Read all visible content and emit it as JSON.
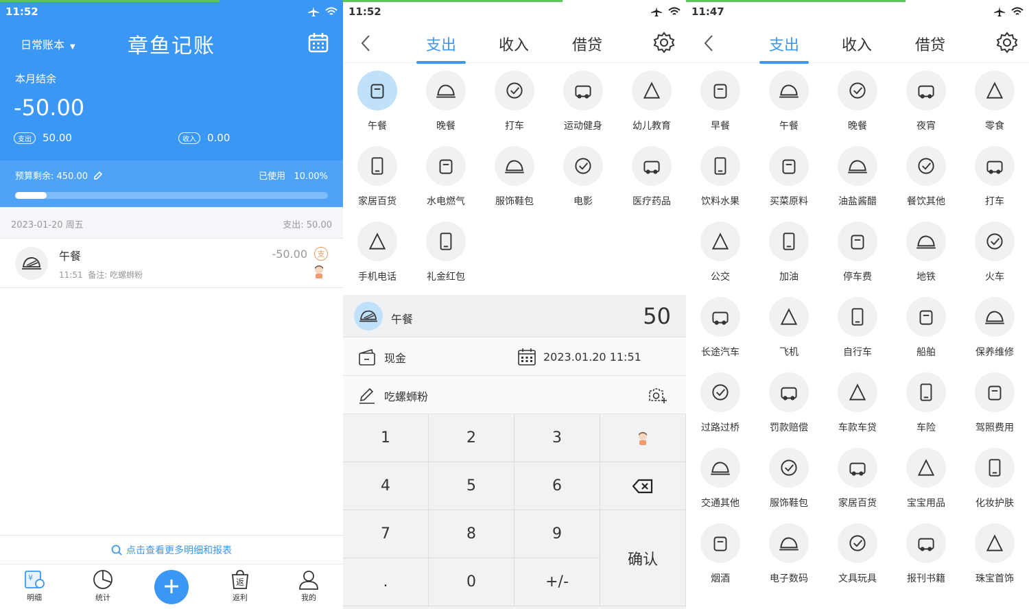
{
  "p1": {
    "status_time": "11:52",
    "book": "日常账本",
    "title": "章鱼记账",
    "balance_label": "本月结余",
    "balance": "-50.00",
    "expense_pill": "支出",
    "expense": "50.00",
    "income_pill": "收入",
    "income": "0.00",
    "budget_left": "预算剩余: 450.00",
    "used_label": "已使用",
    "used_pct": "10.00%",
    "used_fraction": 0.1,
    "day": "2023-01-20 周五",
    "day_total": "支出: 50.00",
    "entry": {
      "name": "午餐",
      "time": "11:51",
      "note": "备注: 吃螺蛳粉",
      "amount": "-50.00",
      "tag": "支"
    },
    "more": "点击查看更多明细和报表",
    "tabs": [
      "明细",
      "统计",
      "返利",
      "我的"
    ]
  },
  "p2": {
    "status_time": "11:52",
    "tabs": [
      "支出",
      "收入",
      "借贷"
    ],
    "categories": [
      "午餐",
      "晚餐",
      "打车",
      "运动健身",
      "幼儿教育",
      "家居百货",
      "水电燃气",
      "服饰鞋包",
      "电影",
      "医疗药品",
      "手机电话",
      "礼金红包"
    ],
    "selected": "午餐",
    "amount": "50",
    "account": "现金",
    "datetime": "2023.01.20 11:51",
    "note": "吃螺蛳粉",
    "keys": [
      "1",
      "2",
      "3",
      "4",
      "5",
      "6",
      "7",
      "8",
      "9",
      ".",
      "0",
      "+/-"
    ],
    "confirm": "确认"
  },
  "p3": {
    "status_time": "11:47",
    "tabs": [
      "支出",
      "收入",
      "借贷"
    ],
    "categories": [
      "早餐",
      "午餐",
      "晚餐",
      "夜宵",
      "零食",
      "饮料水果",
      "买菜原料",
      "油盐酱醋",
      "餐饮其他",
      "打车",
      "公交",
      "加油",
      "停车费",
      "地铁",
      "火车",
      "长途汽车",
      "飞机",
      "自行车",
      "船舶",
      "保养维修",
      "过路过桥",
      "罚款赔偿",
      "车款车贷",
      "车险",
      "驾照费用",
      "交通其他",
      "服饰鞋包",
      "家居百货",
      "宝宝用品",
      "化妆护肤",
      "烟酒",
      "电子数码",
      "文具玩具",
      "报刊书籍",
      "珠宝首饰"
    ]
  },
  "colors": {
    "accent": "#3b97f4",
    "selected_bg": "#bfe1fb",
    "expense_tag": "#e89a5c"
  }
}
